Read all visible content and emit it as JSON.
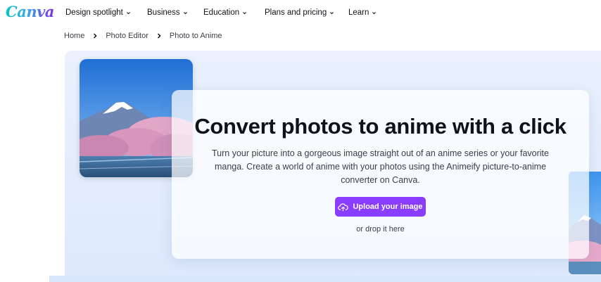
{
  "brand": {
    "logo_text": "Canva",
    "accent": "#8b3dff"
  },
  "nav": {
    "items": [
      {
        "label": "Design spotlight"
      },
      {
        "label": "Business"
      },
      {
        "label": "Education"
      },
      {
        "label": "Plans and pricing"
      },
      {
        "label": "Learn"
      }
    ]
  },
  "breadcrumb": [
    "Home",
    "Photo Editor",
    "Photo to Anime"
  ],
  "hero": {
    "title": "Convert photos to anime with a click",
    "description": "Turn your picture into a gorgeous image straight out of an anime series or your favorite manga. Create a world of anime with your photos using the Animeify picture-to-anime converter on Canva.",
    "upload_label": "Upload your image",
    "drop_text": "or drop it here",
    "upload_icon": "cloud-upload-icon"
  }
}
